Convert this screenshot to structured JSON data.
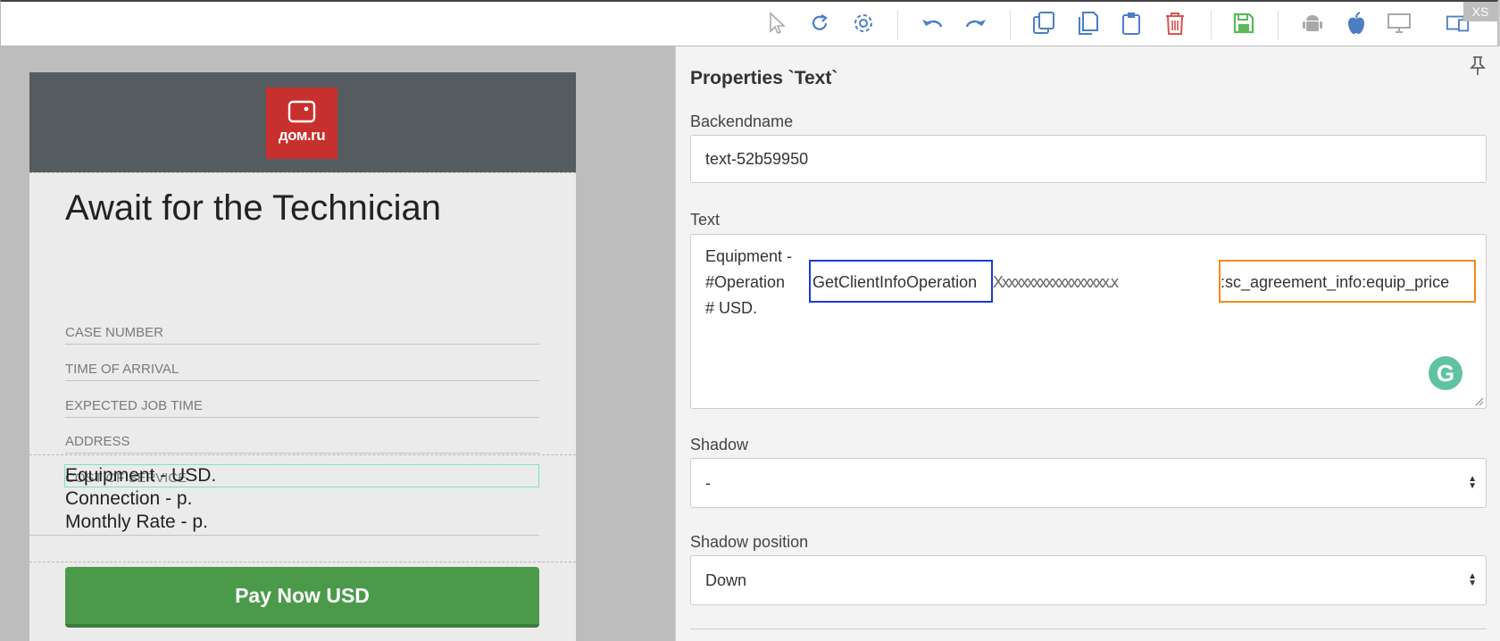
{
  "toolbar": {
    "badge": "XS",
    "colors": {
      "blue": "#4a7fc4",
      "red": "#d9534f",
      "green": "#5cb85c",
      "gray": "#a8a8a8"
    },
    "icons": [
      "cursor-icon",
      "refresh-icon",
      "gear-icon",
      "undo-icon",
      "redo-icon",
      "copy-icon",
      "duplicate-icon",
      "clipboard-icon",
      "trash-icon",
      "save-icon",
      "android-icon",
      "apple-icon",
      "desktop-icon",
      "tablet-icon"
    ]
  },
  "phone": {
    "logo_text": "дом.ru",
    "title": "Await for the Technician",
    "fields": [
      "CASE NUMBER",
      "TIME OF ARRIVAL",
      "EXPECTED JOB TIME",
      "ADDRESS",
      "COST OF SERVICE"
    ],
    "cost_lines": [
      "Equipment  -  USD.",
      "Connection  -  p.",
      "Monthly Rate -  p."
    ],
    "pay_button": "Pay Now USD"
  },
  "panel": {
    "title": "Properties `Text`",
    "backendname_label": "Backendname",
    "backendname_value": "text-52b59950",
    "text_label": "Text",
    "text_line1": "Equipment  -",
    "text_line2_prefix": "#Operation",
    "text_line2_blue": "GetClientInfoOperation",
    "text_line2_garbled": "Xxxxxxxxxxxxxxxxxx.x",
    "text_line2_orange": ":sc_agreement_info:equip_price",
    "text_line3": "# USD.",
    "grammarly_glyph": "G",
    "shadow_label": "Shadow",
    "shadow_value": "-",
    "shadow_position_label": "Shadow position",
    "shadow_position_value": "Down"
  }
}
